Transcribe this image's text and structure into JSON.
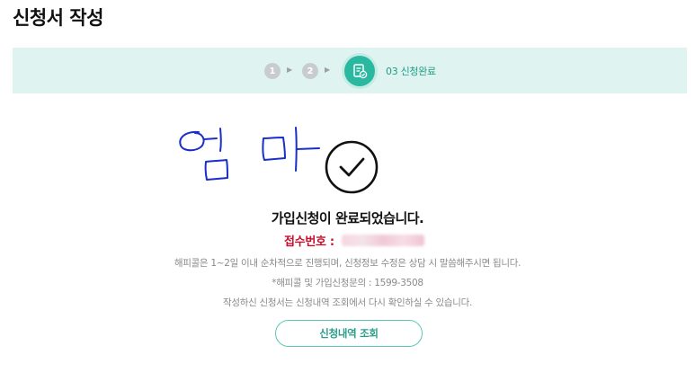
{
  "page": {
    "title": "신청서 작성"
  },
  "stepper": {
    "steps": [
      {
        "number": "1"
      },
      {
        "number": "2"
      },
      {
        "label": "03 신청완료",
        "icon": "document-check-icon",
        "active": true
      }
    ],
    "accent": "#2bb8a0"
  },
  "handwriting_text": "엄마",
  "result": {
    "message": "가입신청이 완료되었습니다.",
    "receipt_label": "접수번호 :"
  },
  "info": {
    "line1": "해피콜은 1~2일 이내 순차적으로 진행되며, 신청정보 수정은 상담 시 말씀해주시면 됩니다.",
    "line2": "*해피콜 및 가입신청문의 : 1599-3508",
    "line3": "작성하신 신청서는 신청내역 조회에서 다시 확인하실 수 있습니다."
  },
  "actions": {
    "history_button": "신청내역 조회"
  }
}
